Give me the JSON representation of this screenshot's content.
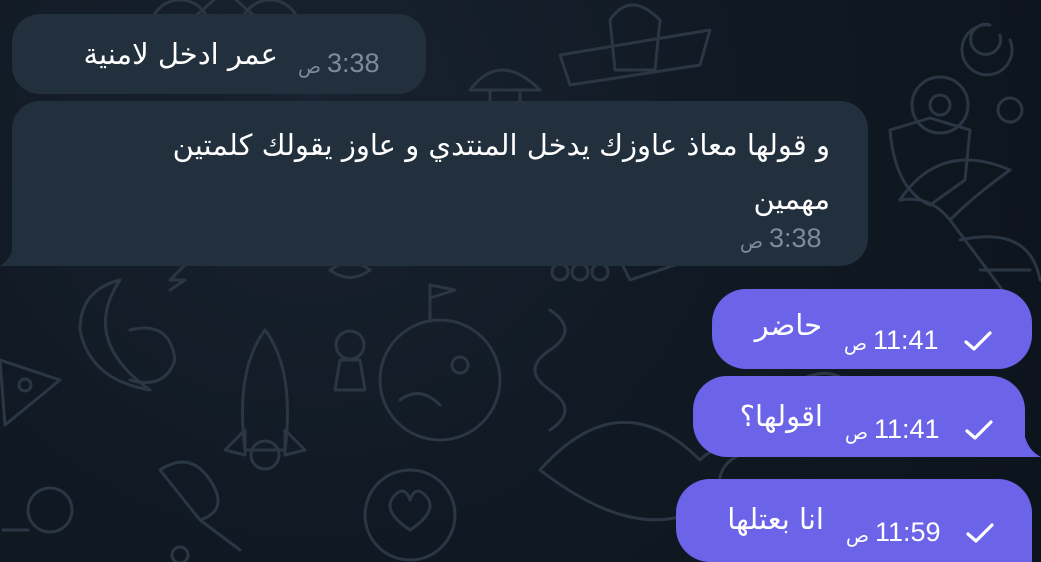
{
  "colors": {
    "background": "#0e1621",
    "incoming_bubble": "#222f3c",
    "outgoing_bubble": "#6b63e8",
    "incoming_time": "#7c8c9d",
    "outgoing_text": "#ffffff"
  },
  "messages": [
    {
      "direction": "incoming",
      "text": "عمر ادخل لامنية",
      "time": "3:38",
      "ampm": "ص"
    },
    {
      "direction": "incoming",
      "text_line1": "و قولها معاذ عاوزك يدخل المنتدي و عاوز يقولك كلمتين",
      "text_line2": "مهمين",
      "time": "3:38",
      "ampm": "ص"
    },
    {
      "direction": "outgoing",
      "text": "حاضر",
      "time": "11:41",
      "ampm": "ص",
      "status_icon": "single-check-icon"
    },
    {
      "direction": "outgoing",
      "text": "اقولها؟",
      "time": "11:41",
      "ampm": "ص",
      "status_icon": "single-check-icon"
    },
    {
      "direction": "outgoing",
      "text": "انا بعتلها",
      "time": "11:59",
      "ampm": "ص",
      "status_icon": "single-check-icon"
    }
  ]
}
